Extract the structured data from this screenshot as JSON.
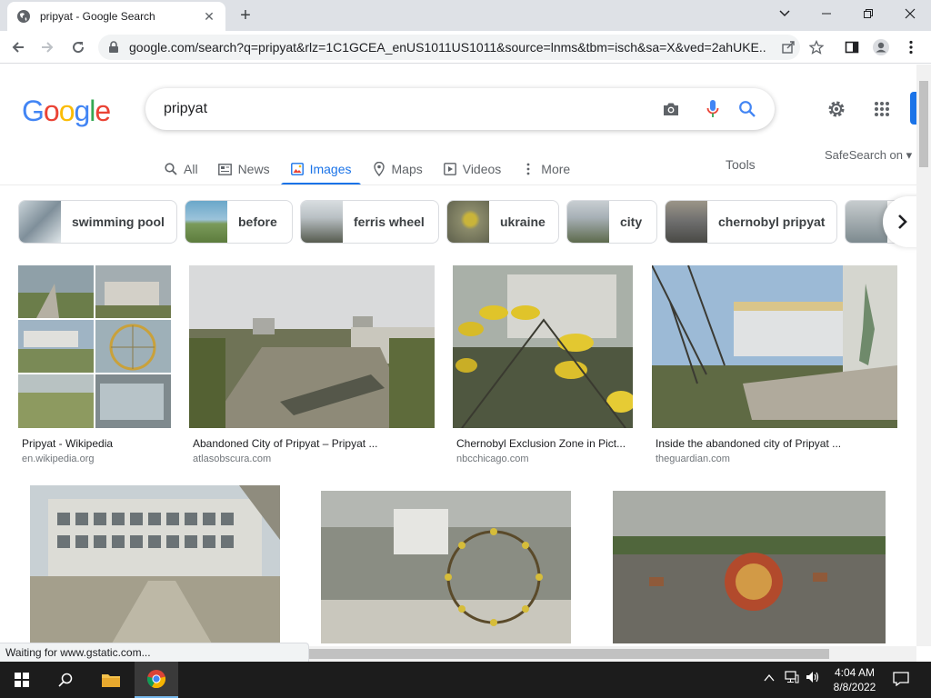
{
  "browser": {
    "tab_title": "pripyat - Google Search",
    "url": "google.com/search?q=pripyat&rlz=1C1GCEA_enUS1011US1011&source=lnms&tbm=isch&sa=X&ved=2ahUKE...",
    "status": "Waiting for www.gstatic.com..."
  },
  "google": {
    "logo": [
      "G",
      "o",
      "o",
      "g",
      "l",
      "e"
    ],
    "logo_colors": [
      "#4285F4",
      "#EA4335",
      "#FBBC05",
      "#4285F4",
      "#34A853",
      "#EA4335"
    ],
    "query": "pripyat",
    "tabs": [
      {
        "label": "All",
        "icon": "search-icon"
      },
      {
        "label": "News",
        "icon": "news-icon"
      },
      {
        "label": "Images",
        "icon": "image-icon",
        "active": true
      },
      {
        "label": "Maps",
        "icon": "map-pin-icon"
      },
      {
        "label": "Videos",
        "icon": "video-icon"
      },
      {
        "label": "More",
        "icon": "more-vert-icon"
      }
    ],
    "tools": "Tools",
    "safesearch": "SafeSearch on"
  },
  "chips": [
    {
      "label": "swimming pool",
      "colors": [
        "#7f8f9a",
        "#c9d3d8"
      ]
    },
    {
      "label": "before",
      "colors": [
        "#6aa7c9",
        "#7a9a5a"
      ]
    },
    {
      "label": "ferris wheel",
      "colors": [
        "#b9c0c4",
        "#565b4f"
      ]
    },
    {
      "label": "ukraine",
      "colors": [
        "#8a8a6a",
        "#c9b43a"
      ]
    },
    {
      "label": "city",
      "colors": [
        "#a7b0b6",
        "#5d6a4c"
      ]
    },
    {
      "label": "chernobyl pripyat",
      "colors": [
        "#6d6d6d",
        "#9b9588"
      ]
    },
    {
      "label": "",
      "colors": [
        "#7d8a8f",
        "#c7ccce"
      ]
    }
  ],
  "results": [
    {
      "caption": "Pripyat - Wikipedia",
      "source": "en.wikipedia.org"
    },
    {
      "caption": "Abandoned City of Pripyat – Pripyat ...",
      "source": "atlasobscura.com"
    },
    {
      "caption": "Chernobyl Exclusion Zone in Pict...",
      "source": "nbcchicago.com"
    },
    {
      "caption": "Inside the abandoned city of Pripyat ...",
      "source": "theguardian.com"
    }
  ],
  "taskbar": {
    "time": "4:04 AM",
    "date": "8/8/2022"
  }
}
